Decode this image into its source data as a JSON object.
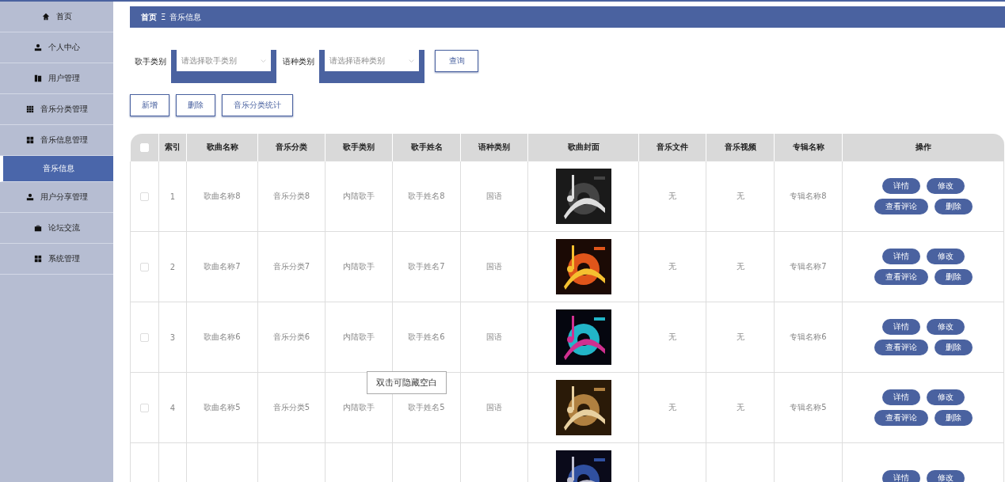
{
  "sidebar": {
    "items": [
      {
        "label": "首页",
        "selected": false
      },
      {
        "label": "个人中心",
        "selected": false
      },
      {
        "label": "用户管理",
        "selected": false
      },
      {
        "label": "音乐分类管理",
        "selected": false
      },
      {
        "label": "音乐信息管理",
        "selected": false
      },
      {
        "label": "音乐信息",
        "selected": true
      },
      {
        "label": "用户分享管理",
        "selected": false
      },
      {
        "label": "论坛交流",
        "selected": false
      },
      {
        "label": "系统管理",
        "selected": false
      }
    ]
  },
  "breadcrumb": {
    "home": "首页",
    "separator": "Ξ",
    "current": "音乐信息"
  },
  "filters": [
    {
      "label": "歌手类别",
      "placeholder": "请选择歌手类别"
    },
    {
      "label": "语种类别",
      "placeholder": "请选择语种类别"
    }
  ],
  "search_button": "查询",
  "actions": [
    "新增",
    "删除",
    "音乐分类统计"
  ],
  "table": {
    "header_checked": false,
    "columns": [
      "索引",
      "歌曲名称",
      "音乐分类",
      "歌手类别",
      "歌手姓名",
      "语种类别",
      "歌曲封面",
      "音乐文件",
      "音乐视频",
      "专辑名称",
      "操作"
    ],
    "rows": [
      {
        "checked": false,
        "cells": [
          "1",
          "歌曲名称8",
          "音乐分类8",
          "内陆歌手",
          "歌手姓名8",
          "国语"
        ],
        "cover": {
          "kind": "picture"
        },
        "cells2": [
          "无",
          "无",
          "专辑名称8"
        ],
        "buttons": [
          "详情",
          "修改",
          "查看评论",
          "删除"
        ]
      },
      {
        "checked": false,
        "cells": [
          "2",
          "歌曲名称7",
          "音乐分类7",
          "内陆歌手",
          "歌手姓名7",
          "国语"
        ],
        "cover": {
          "kind": "picture"
        },
        "cells2": [
          "无",
          "无",
          "专辑名称7"
        ],
        "buttons": [
          "详情",
          "修改",
          "查看评论",
          "删除"
        ]
      },
      {
        "checked": false,
        "cells": [
          "3",
          "歌曲名称6",
          "音乐分类6",
          "内陆歌手",
          "歌手姓名6",
          "国语"
        ],
        "cover": {
          "kind": "picture"
        },
        "cells2": [
          "无",
          "无",
          "专辑名称6"
        ],
        "buttons": [
          "详情",
          "修改",
          "查看评论",
          "删除"
        ]
      },
      {
        "checked": false,
        "cells": [
          "4",
          "歌曲名称5",
          "音乐分类5",
          "内陆歌手",
          "歌手姓名5",
          "国语"
        ],
        "cover": {
          "kind": "picture"
        },
        "cells2": [
          "无",
          "无",
          "专辑名称5"
        ],
        "buttons": [
          "详情",
          "修改",
          "查看评论",
          "删除"
        ]
      },
      {
        "cover": {
          "kind": "picture"
        },
        "buttons": [
          "详情",
          "修改"
        ]
      }
    ]
  },
  "tooltip": "双击可隐藏空白"
}
